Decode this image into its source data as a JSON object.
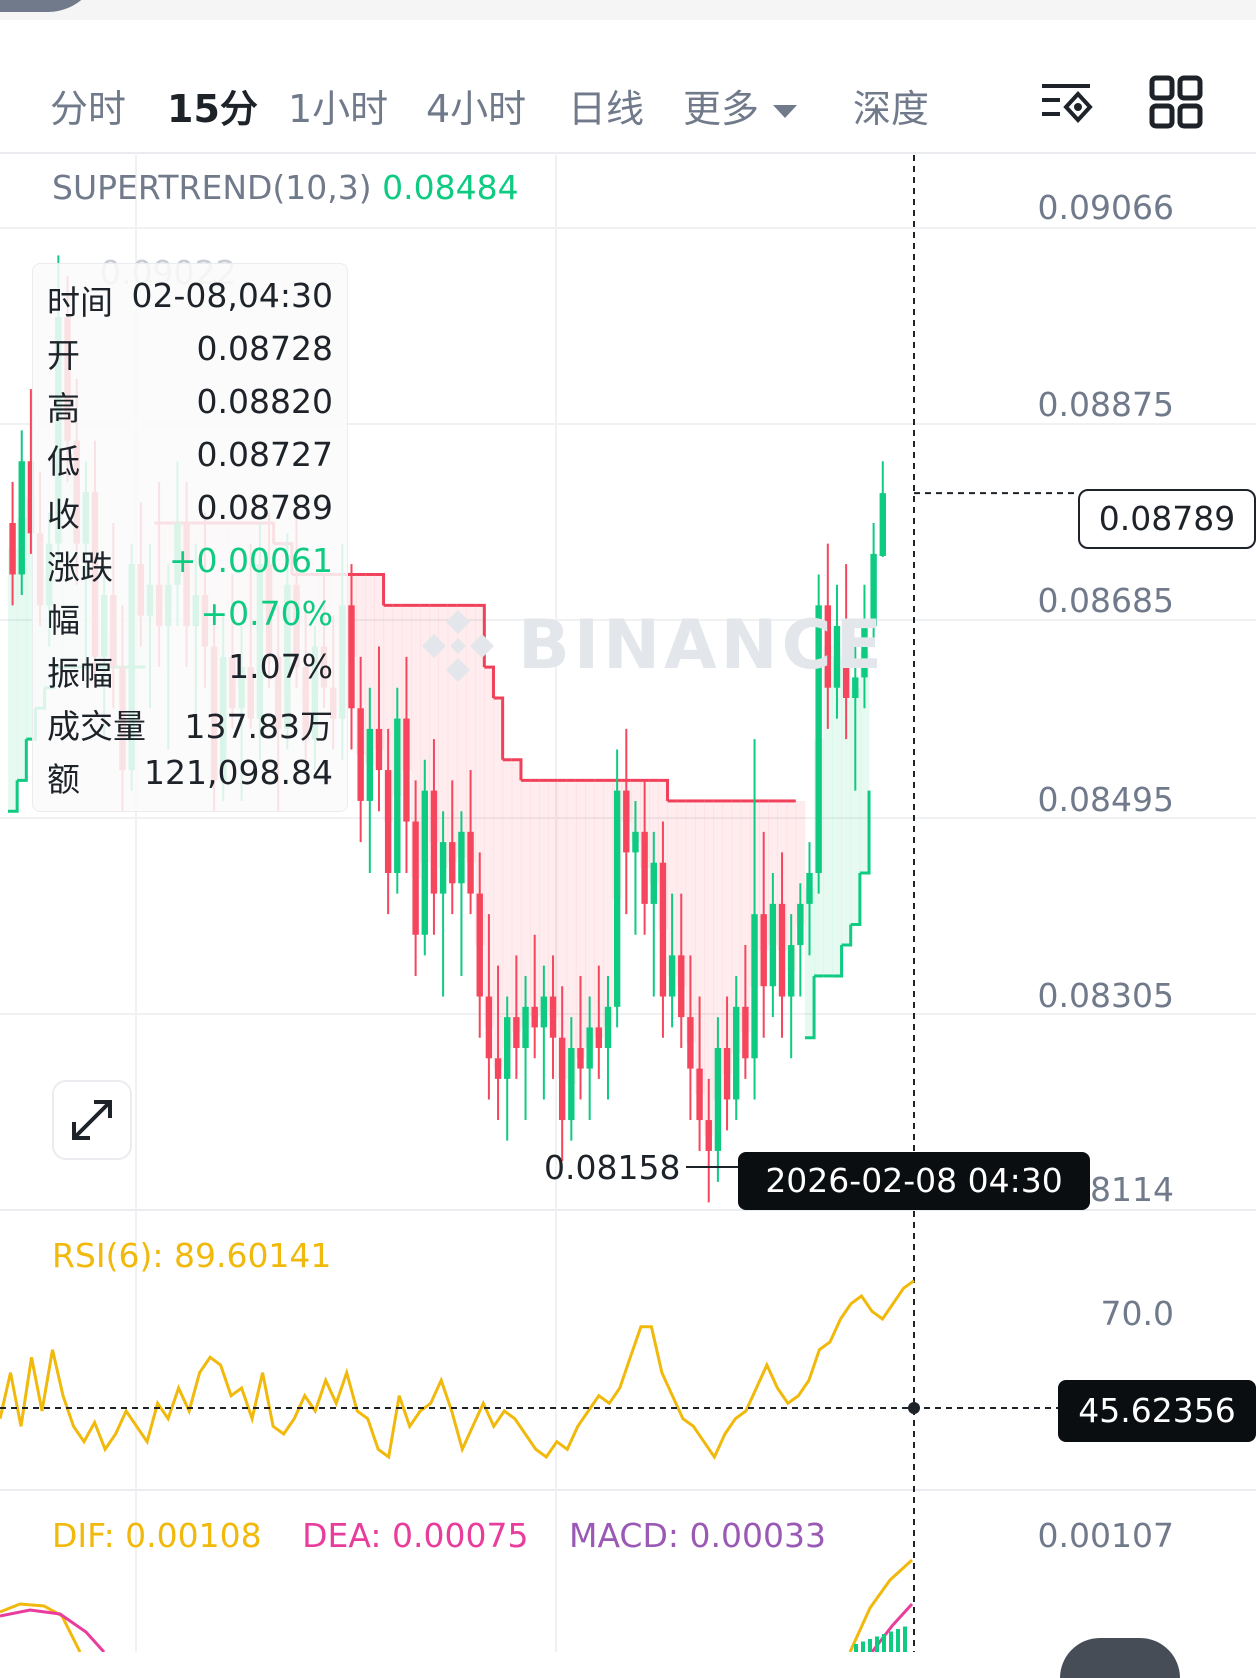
{
  "toolbar": {
    "tabs": [
      {
        "label": "分时",
        "active": false
      },
      {
        "label": "15分",
        "active": true
      },
      {
        "label": "1小时",
        "active": false
      },
      {
        "label": "4小时",
        "active": false
      },
      {
        "label": "日线",
        "active": false
      },
      {
        "label": "更多",
        "active": false
      },
      {
        "label": "深度",
        "active": false
      }
    ],
    "icons": [
      "indicator-settings-icon",
      "layout-grid-icon"
    ]
  },
  "supertrend": {
    "label": "SUPERTREND(10,3)",
    "value": "0.08484"
  },
  "watermark": "BINANCE",
  "price_axis": [
    "0.09066",
    "0.08875",
    "0.08685",
    "0.08495",
    "0.08305",
    "0.08114"
  ],
  "current_price": "0.08789",
  "ghost_high": "0.09022",
  "low_marker": "0.08158",
  "crosshair_time": "2026-02-08 04:30",
  "info": {
    "rows": [
      {
        "k": "时间",
        "v": "02-08,04:30"
      },
      {
        "k": "开",
        "v": "0.08728"
      },
      {
        "k": "高",
        "v": "0.08820"
      },
      {
        "k": "低",
        "v": "0.08727"
      },
      {
        "k": "收",
        "v": "0.08789"
      },
      {
        "k": "涨跌",
        "v": "+0.00061"
      },
      {
        "k": "幅",
        "v": "+0.70%"
      },
      {
        "k": "振幅",
        "v": "1.07%"
      },
      {
        "k": "成交量",
        "v": "137.83万"
      },
      {
        "k": "额",
        "v": "121,098.84"
      }
    ]
  },
  "rsi": {
    "label": "RSI(6): 89.60141",
    "axis_level": "70.0",
    "crosshair_value": "45.62356"
  },
  "macd": {
    "dif": "DIF: 0.00108",
    "dea": "DEA: 0.00075",
    "macd": "MACD: 0.00033",
    "axis_value": "0.00107"
  },
  "colors": {
    "up": "#0ecb81",
    "down": "#f6465d",
    "supertrend_down": "#f0405a",
    "rsi": "#f0b90b",
    "dif": "#f0b90b",
    "dea": "#e83d9c",
    "macd_label": "#9b59b6"
  },
  "chart_data": {
    "type": "candlestick",
    "timeframe": "15分",
    "ylim": [
      0.08114,
      0.09066
    ],
    "candles": [
      {
        "o": 0.0876,
        "h": 0.088,
        "l": 0.0868,
        "c": 0.0871
      },
      {
        "o": 0.0871,
        "h": 0.0885,
        "l": 0.0869,
        "c": 0.0882
      },
      {
        "o": 0.0882,
        "h": 0.0889,
        "l": 0.0873,
        "c": 0.0875
      },
      {
        "o": 0.0875,
        "h": 0.0881,
        "l": 0.0866,
        "c": 0.0868
      },
      {
        "o": 0.0868,
        "h": 0.0877,
        "l": 0.0864,
        "c": 0.0874
      },
      {
        "o": 0.0874,
        "h": 0.0902,
        "l": 0.0872,
        "c": 0.0896
      },
      {
        "o": 0.0896,
        "h": 0.09,
        "l": 0.088,
        "c": 0.0884
      },
      {
        "o": 0.0884,
        "h": 0.089,
        "l": 0.087,
        "c": 0.0874
      },
      {
        "o": 0.0874,
        "h": 0.0882,
        "l": 0.0862,
        "c": 0.0879
      },
      {
        "o": 0.0879,
        "h": 0.0884,
        "l": 0.086,
        "c": 0.0863
      },
      {
        "o": 0.0863,
        "h": 0.0872,
        "l": 0.0855,
        "c": 0.0869
      },
      {
        "o": 0.0869,
        "h": 0.0876,
        "l": 0.0858,
        "c": 0.0862
      },
      {
        "o": 0.0862,
        "h": 0.0868,
        "l": 0.0848,
        "c": 0.0852
      },
      {
        "o": 0.0852,
        "h": 0.0874,
        "l": 0.085,
        "c": 0.0872
      },
      {
        "o": 0.0872,
        "h": 0.0878,
        "l": 0.0864,
        "c": 0.0867
      },
      {
        "o": 0.0867,
        "h": 0.0874,
        "l": 0.0858,
        "c": 0.087
      },
      {
        "o": 0.087,
        "h": 0.088,
        "l": 0.0862,
        "c": 0.0866
      },
      {
        "o": 0.0866,
        "h": 0.0872,
        "l": 0.0854,
        "c": 0.087
      },
      {
        "o": 0.087,
        "h": 0.0882,
        "l": 0.0866,
        "c": 0.0876
      },
      {
        "o": 0.0876,
        "h": 0.088,
        "l": 0.0862,
        "c": 0.0866
      },
      {
        "o": 0.0866,
        "h": 0.0874,
        "l": 0.0856,
        "c": 0.0869
      },
      {
        "o": 0.0869,
        "h": 0.0877,
        "l": 0.086,
        "c": 0.0864
      },
      {
        "o": 0.0864,
        "h": 0.0868,
        "l": 0.0848,
        "c": 0.0851
      },
      {
        "o": 0.0851,
        "h": 0.0867,
        "l": 0.0849,
        "c": 0.0863
      },
      {
        "o": 0.0863,
        "h": 0.0871,
        "l": 0.0856,
        "c": 0.0858
      },
      {
        "o": 0.0858,
        "h": 0.0866,
        "l": 0.0849,
        "c": 0.0862
      },
      {
        "o": 0.0862,
        "h": 0.0874,
        "l": 0.0856,
        "c": 0.0857
      },
      {
        "o": 0.0857,
        "h": 0.0876,
        "l": 0.0853,
        "c": 0.0872
      },
      {
        "o": 0.0872,
        "h": 0.0877,
        "l": 0.086,
        "c": 0.0863
      },
      {
        "o": 0.0863,
        "h": 0.0868,
        "l": 0.0848,
        "c": 0.0856
      },
      {
        "o": 0.0856,
        "h": 0.0875,
        "l": 0.0854,
        "c": 0.087
      },
      {
        "o": 0.087,
        "h": 0.0878,
        "l": 0.086,
        "c": 0.0862
      },
      {
        "o": 0.0862,
        "h": 0.0868,
        "l": 0.0852,
        "c": 0.0855
      },
      {
        "o": 0.0855,
        "h": 0.0866,
        "l": 0.0852,
        "c": 0.0864
      },
      {
        "o": 0.0864,
        "h": 0.0871,
        "l": 0.0858,
        "c": 0.086
      },
      {
        "o": 0.086,
        "h": 0.0867,
        "l": 0.0854,
        "c": 0.0857
      },
      {
        "o": 0.0857,
        "h": 0.0874,
        "l": 0.0853,
        "c": 0.0868
      },
      {
        "o": 0.0868,
        "h": 0.0872,
        "l": 0.0854,
        "c": 0.0858
      },
      {
        "o": 0.0858,
        "h": 0.0863,
        "l": 0.0845,
        "c": 0.0849
      },
      {
        "o": 0.0849,
        "h": 0.086,
        "l": 0.0842,
        "c": 0.0856
      },
      {
        "o": 0.0856,
        "h": 0.0864,
        "l": 0.0848,
        "c": 0.0852
      },
      {
        "o": 0.0852,
        "h": 0.0856,
        "l": 0.0838,
        "c": 0.0842
      },
      {
        "o": 0.0842,
        "h": 0.086,
        "l": 0.084,
        "c": 0.0857
      },
      {
        "o": 0.0857,
        "h": 0.0863,
        "l": 0.0842,
        "c": 0.0847
      },
      {
        "o": 0.0847,
        "h": 0.0851,
        "l": 0.0832,
        "c": 0.0836
      },
      {
        "o": 0.0836,
        "h": 0.0853,
        "l": 0.0834,
        "c": 0.085
      },
      {
        "o": 0.085,
        "h": 0.0855,
        "l": 0.0836,
        "c": 0.084
      },
      {
        "o": 0.084,
        "h": 0.0848,
        "l": 0.083,
        "c": 0.0845
      },
      {
        "o": 0.0845,
        "h": 0.0851,
        "l": 0.0838,
        "c": 0.0841
      },
      {
        "o": 0.0841,
        "h": 0.0848,
        "l": 0.0832,
        "c": 0.0846
      },
      {
        "o": 0.0846,
        "h": 0.0852,
        "l": 0.0838,
        "c": 0.084
      },
      {
        "o": 0.084,
        "h": 0.0844,
        "l": 0.0826,
        "c": 0.083
      },
      {
        "o": 0.083,
        "h": 0.0838,
        "l": 0.082,
        "c": 0.0824
      },
      {
        "o": 0.0824,
        "h": 0.0833,
        "l": 0.0818,
        "c": 0.0822
      },
      {
        "o": 0.0822,
        "h": 0.083,
        "l": 0.0816,
        "c": 0.0828
      },
      {
        "o": 0.0828,
        "h": 0.0834,
        "l": 0.0822,
        "c": 0.0825
      },
      {
        "o": 0.0825,
        "h": 0.0832,
        "l": 0.0818,
        "c": 0.0829
      },
      {
        "o": 0.0829,
        "h": 0.0836,
        "l": 0.0824,
        "c": 0.0827
      },
      {
        "o": 0.0827,
        "h": 0.0833,
        "l": 0.082,
        "c": 0.083
      },
      {
        "o": 0.083,
        "h": 0.0834,
        "l": 0.0822,
        "c": 0.0826
      },
      {
        "o": 0.0826,
        "h": 0.0831,
        "l": 0.0814,
        "c": 0.0818
      },
      {
        "o": 0.0818,
        "h": 0.0828,
        "l": 0.0816,
        "c": 0.0825
      },
      {
        "o": 0.0825,
        "h": 0.0832,
        "l": 0.082,
        "c": 0.0823
      },
      {
        "o": 0.0823,
        "h": 0.083,
        "l": 0.0818,
        "c": 0.0827
      },
      {
        "o": 0.0827,
        "h": 0.0833,
        "l": 0.0822,
        "c": 0.0825
      },
      {
        "o": 0.0825,
        "h": 0.0832,
        "l": 0.082,
        "c": 0.0829
      },
      {
        "o": 0.0829,
        "h": 0.0854,
        "l": 0.0827,
        "c": 0.085
      },
      {
        "o": 0.085,
        "h": 0.0856,
        "l": 0.0838,
        "c": 0.0844
      },
      {
        "o": 0.0844,
        "h": 0.0849,
        "l": 0.0836,
        "c": 0.0846
      },
      {
        "o": 0.0846,
        "h": 0.0851,
        "l": 0.0836,
        "c": 0.0839
      },
      {
        "o": 0.0839,
        "h": 0.0846,
        "l": 0.083,
        "c": 0.0843
      },
      {
        "o": 0.0843,
        "h": 0.0847,
        "l": 0.0826,
        "c": 0.083
      },
      {
        "o": 0.083,
        "h": 0.084,
        "l": 0.0827,
        "c": 0.0834
      },
      {
        "o": 0.0834,
        "h": 0.084,
        "l": 0.0825,
        "c": 0.0828
      },
      {
        "o": 0.0828,
        "h": 0.0834,
        "l": 0.0818,
        "c": 0.0823
      },
      {
        "o": 0.0823,
        "h": 0.083,
        "l": 0.0815,
        "c": 0.0818
      },
      {
        "o": 0.0818,
        "h": 0.0822,
        "l": 0.081,
        "c": 0.0815
      },
      {
        "o": 0.0815,
        "h": 0.0828,
        "l": 0.0812,
        "c": 0.0825
      },
      {
        "o": 0.0825,
        "h": 0.083,
        "l": 0.0817,
        "c": 0.082
      },
      {
        "o": 0.082,
        "h": 0.0832,
        "l": 0.0818,
        "c": 0.0829
      },
      {
        "o": 0.0829,
        "h": 0.0835,
        "l": 0.0822,
        "c": 0.0824
      },
      {
        "o": 0.0824,
        "h": 0.0855,
        "l": 0.082,
        "c": 0.0838
      },
      {
        "o": 0.0838,
        "h": 0.0846,
        "l": 0.0826,
        "c": 0.0831
      },
      {
        "o": 0.0831,
        "h": 0.0842,
        "l": 0.0828,
        "c": 0.0839
      },
      {
        "o": 0.0839,
        "h": 0.0844,
        "l": 0.0826,
        "c": 0.083
      },
      {
        "o": 0.083,
        "h": 0.0838,
        "l": 0.0824,
        "c": 0.0835
      },
      {
        "o": 0.0835,
        "h": 0.0841,
        "l": 0.083,
        "c": 0.0839
      },
      {
        "o": 0.0839,
        "h": 0.0845,
        "l": 0.0834,
        "c": 0.0842
      },
      {
        "o": 0.0842,
        "h": 0.0871,
        "l": 0.084,
        "c": 0.0868
      },
      {
        "o": 0.0868,
        "h": 0.0874,
        "l": 0.0856,
        "c": 0.086
      },
      {
        "o": 0.086,
        "h": 0.087,
        "l": 0.0857,
        "c": 0.0866
      },
      {
        "o": 0.0866,
        "h": 0.0872,
        "l": 0.0855,
        "c": 0.0859
      },
      {
        "o": 0.0859,
        "h": 0.0864,
        "l": 0.085,
        "c": 0.0861
      },
      {
        "o": 0.0861,
        "h": 0.087,
        "l": 0.0858,
        "c": 0.0866
      },
      {
        "o": 0.0866,
        "h": 0.0876,
        "l": 0.0864,
        "c": 0.0873
      },
      {
        "o": 0.08728,
        "h": 0.0882,
        "l": 0.08727,
        "c": 0.08789
      }
    ],
    "supertrend": [
      0.0848,
      0.0851,
      0.0855,
      0.0858,
      0.086,
      0.0862,
      0.0862,
      0.0862,
      0.0862,
      0.0862,
      0.0862,
      0.0862,
      0.0862,
      0.0862,
      0.0862,
      0.0862,
      0.0876,
      0.0876,
      0.0876,
      0.0876,
      0.0876,
      0.0876,
      0.0876,
      0.0876,
      0.0876,
      0.0876,
      0.0876,
      0.0876,
      0.0876,
      0.0874,
      0.0874,
      0.0871,
      0.0871,
      0.0871,
      0.0871,
      0.0871,
      0.0871,
      0.0871,
      0.0871,
      0.0871,
      0.0871,
      0.0868,
      0.0868,
      0.0868,
      0.0868,
      0.0868,
      0.0868,
      0.0868,
      0.0868,
      0.0868,
      0.0868,
      0.0868,
      0.0862,
      0.0859,
      0.0853,
      0.0853,
      0.0851,
      0.0851,
      0.0851,
      0.0851,
      0.0851,
      0.0851,
      0.0851,
      0.0851,
      0.0851,
      0.0851,
      0.0851,
      0.0851,
      0.0851,
      0.0851,
      0.0851,
      0.0851,
      0.0849,
      0.0849,
      0.0849,
      0.0849,
      0.0849,
      0.0849,
      0.0849,
      0.0849,
      0.0849,
      0.0849,
      0.0849,
      0.0849,
      0.0849,
      0.0849,
      0.0849,
      0.0826,
      0.0832,
      0.0832,
      0.0832,
      0.0835,
      0.0837,
      0.0842,
      0.085
    ],
    "supertrend_dir": [
      "up",
      "up",
      "up",
      "up",
      "up",
      "up",
      "up",
      "up",
      "up",
      "up",
      "up",
      "up",
      "up",
      "up",
      "up",
      "up",
      "down",
      "down",
      "down",
      "down",
      "down",
      "down",
      "down",
      "down",
      "down",
      "down",
      "down",
      "down",
      "down",
      "down",
      "down",
      "down",
      "down",
      "down",
      "down",
      "down",
      "down",
      "down",
      "down",
      "down",
      "down",
      "down",
      "down",
      "down",
      "down",
      "down",
      "down",
      "down",
      "down",
      "down",
      "down",
      "down",
      "down",
      "down",
      "down",
      "down",
      "down",
      "down",
      "down",
      "down",
      "down",
      "down",
      "down",
      "down",
      "down",
      "down",
      "down",
      "down",
      "down",
      "down",
      "down",
      "down",
      "down",
      "down",
      "down",
      "down",
      "down",
      "down",
      "down",
      "down",
      "down",
      "down",
      "down",
      "down",
      "down",
      "down",
      "down",
      "up",
      "up",
      "up",
      "up",
      "up",
      "up",
      "up",
      "up"
    ],
    "rsi_values": [
      46,
      58,
      44,
      62,
      48,
      64,
      52,
      44,
      40,
      45,
      38,
      42,
      48,
      44,
      40,
      50,
      46,
      54,
      48,
      58,
      62,
      60,
      52,
      54,
      46,
      58,
      44,
      42,
      46,
      52,
      48,
      56,
      50,
      58,
      48,
      46,
      38,
      36,
      52,
      44,
      48,
      50,
      56,
      48,
      38,
      44,
      50,
      44,
      48,
      46,
      42,
      38,
      36,
      40,
      38,
      44,
      48,
      52,
      50,
      54,
      62,
      70,
      70,
      58,
      52,
      46,
      44,
      40,
      36,
      42,
      46,
      48,
      54,
      60,
      54,
      50,
      52,
      56,
      64,
      66,
      72,
      76,
      78,
      74,
      72,
      76,
      80,
      82
    ],
    "rsi_ylim": [
      30,
      90
    ],
    "macd": {
      "dif": 0.00108,
      "dea": 0.00075,
      "hist": 0.00033
    }
  }
}
